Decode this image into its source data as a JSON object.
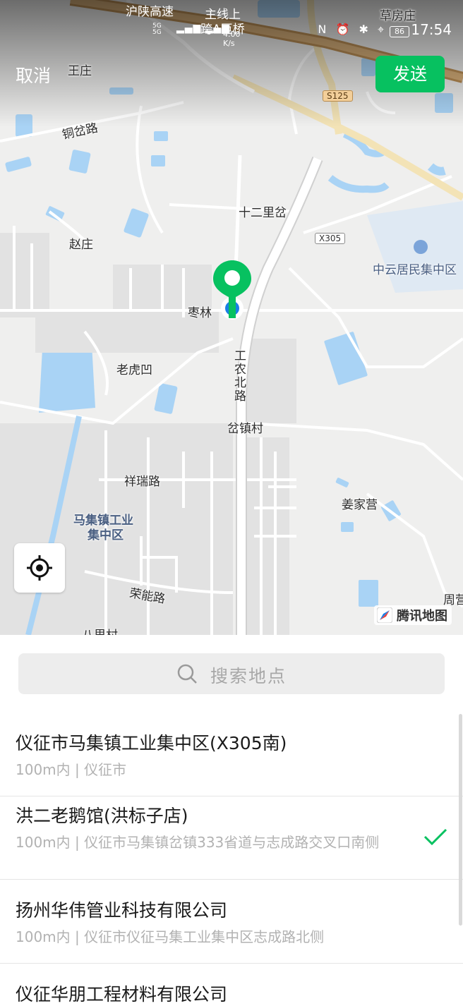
{
  "status_bar": {
    "net_top": "5G",
    "net_bottom": "5G",
    "speed_value": "4.00",
    "speed_unit": "K/s",
    "icons": "N ⏰ ✱ ⌖",
    "battery": "86",
    "time": "17:54"
  },
  "header": {
    "cancel_label": "取消",
    "send_label": "发送"
  },
  "map": {
    "labels": {
      "hushan": "沪陕高速",
      "zhuxian": "主线上",
      "kuabridge": "跨A匝桥",
      "caofang": "草房庄",
      "wangzhuang": "王庄",
      "tongpen": "铜岔路",
      "shierlipen": "十二里岔",
      "zhaozhuang": "赵庄",
      "zhongyun": "中云居民集中区",
      "zaolin": "枣林",
      "laohu": "老虎凹",
      "gongnong": "工农北路",
      "penzhen": "岔镇村",
      "xiangrui": "祥瑞路",
      "jiangjia": "姜家营",
      "majizhen_1": "马集镇工业",
      "majizhen_2": "集中区",
      "rongneng": "荣能路",
      "zhou": "周营",
      "balicun": "八里村"
    },
    "shields": {
      "s125": "S125",
      "x305": "X305"
    },
    "brand": "腾讯地图",
    "accent_green": "#07c160",
    "user_location_blue": "#1a7fe5"
  },
  "search": {
    "placeholder": "搜索地点"
  },
  "results": [
    {
      "name": "仪征市马集镇工业集中区(X305南)",
      "address": "100m内 | 仪征市",
      "selected": false
    },
    {
      "name": "洪二老鹅馆(洪标子店)",
      "address": "100m内 | 仪征市马集镇岔镇333省道与志成路交叉口南侧",
      "selected": true
    },
    {
      "name": "扬州华伟管业科技有限公司",
      "address": "100m内 | 仪征市仪征马集工业集中区志成路北侧",
      "selected": false
    },
    {
      "name": "仪征华朋工程材料有限公司",
      "address": "",
      "selected": false
    }
  ]
}
